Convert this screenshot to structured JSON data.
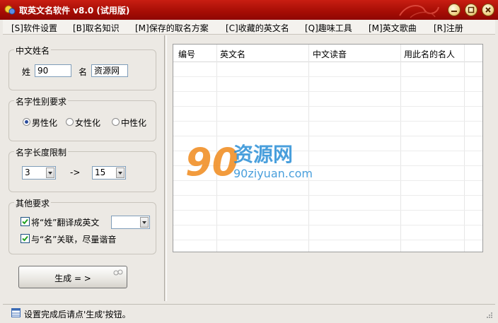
{
  "window": {
    "title": "取英文名软件 v8.0 (试用版)"
  },
  "menu": [
    {
      "label": "[S]软件设置"
    },
    {
      "label": "[B]取名知识"
    },
    {
      "label": "[M]保存的取名方案"
    },
    {
      "label": "[C]收藏的英文名"
    },
    {
      "label": "[Q]趣味工具"
    },
    {
      "label": "[M]英文歌曲"
    },
    {
      "label": "[R]注册"
    }
  ],
  "chinese_name": {
    "group_title": "中文姓名",
    "surname_label": "姓",
    "surname_value": "90",
    "given_label": "名",
    "given_value": "资源网"
  },
  "gender": {
    "group_title": "名字性别要求",
    "options": [
      "男性化",
      "女性化",
      "中性化"
    ],
    "selected": "男性化"
  },
  "length": {
    "group_title": "名字长度限制",
    "min": "3",
    "arrow": "->",
    "max": "15"
  },
  "other": {
    "group_title": "其他要求",
    "option1": "将“姓”翻译成英文",
    "option1_checked": true,
    "option1_select": "",
    "option2": "与“名”关联，尽量谐音",
    "option2_checked": true
  },
  "generate_button": "生成 = >",
  "table": {
    "columns": [
      "编号",
      "英文名",
      "中文读音",
      "用此名的名人"
    ],
    "rows": []
  },
  "watermark": {
    "logo": "90",
    "text": "资源网",
    "domain": "90ziyuan.com"
  },
  "status": {
    "text": "设置完成后请点'生成'按钮。"
  },
  "colors": {
    "titlebar": "#a50d05",
    "watermark_orange": "#f08a1c",
    "watermark_blue": "#2a8fd6"
  }
}
